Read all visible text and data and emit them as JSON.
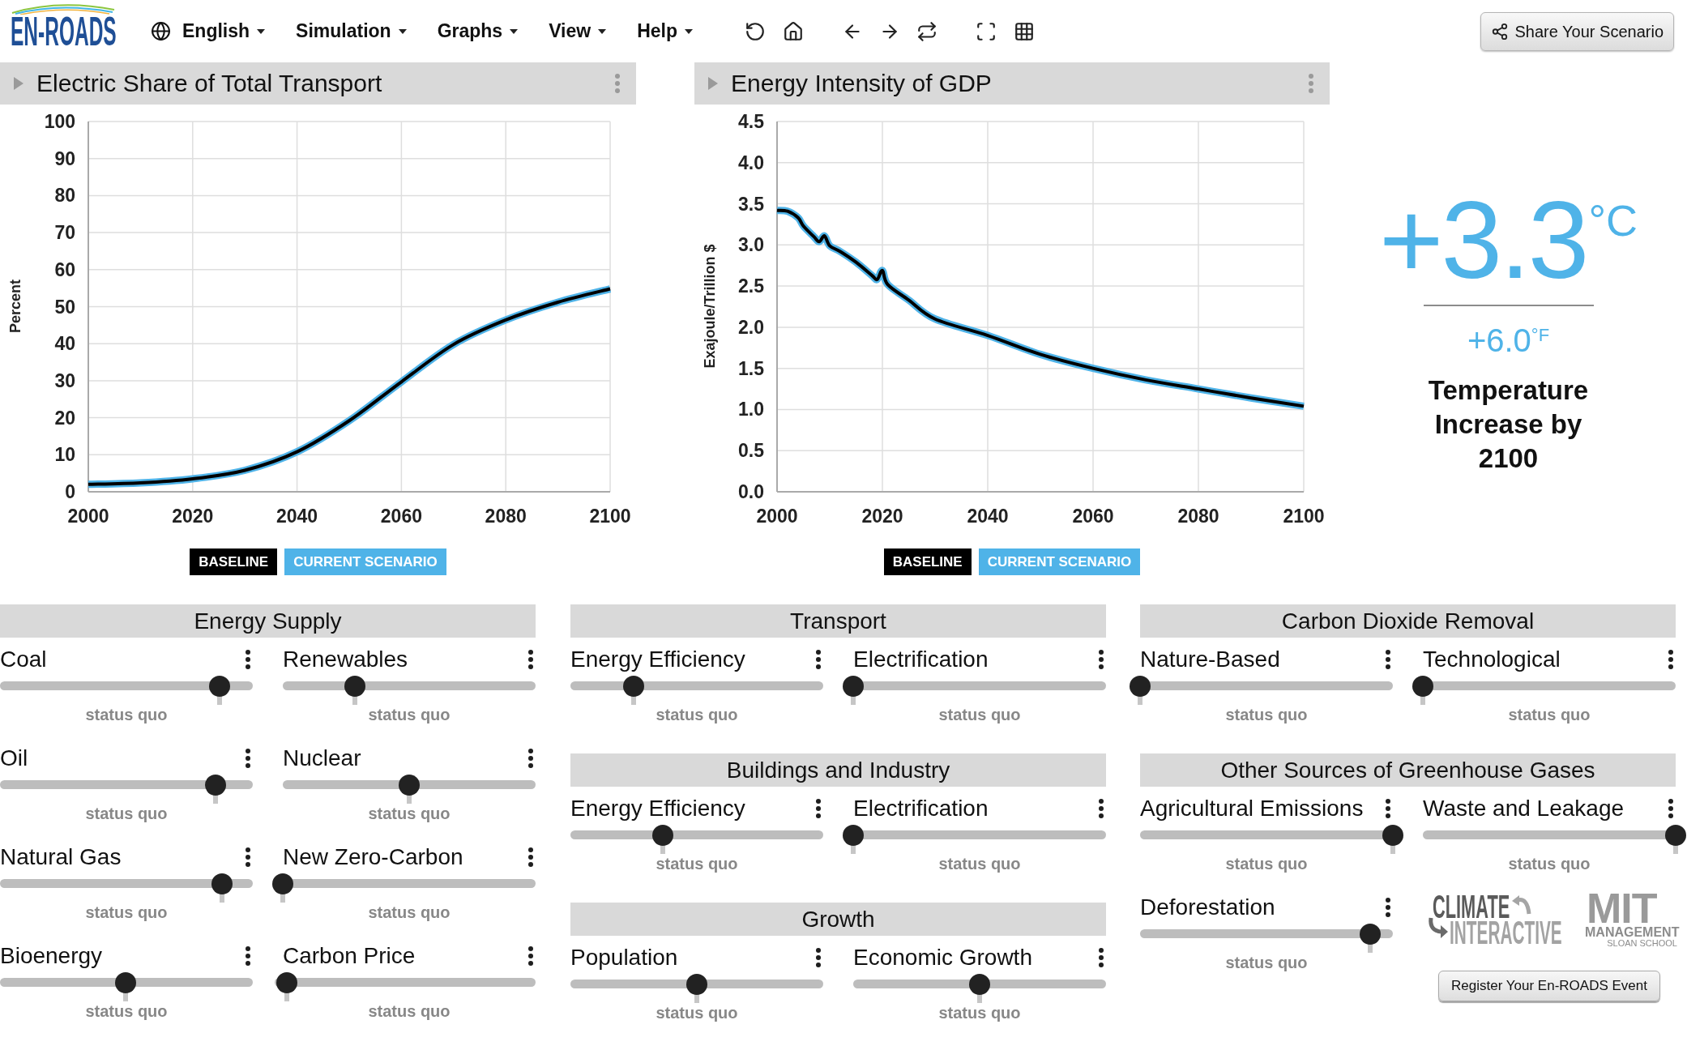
{
  "header": {
    "logo": "EN-ROADS",
    "menus": [
      {
        "kind": "language",
        "label": "English"
      },
      {
        "kind": "menu",
        "label": "Simulation"
      },
      {
        "kind": "menu",
        "label": "Graphs"
      },
      {
        "kind": "menu",
        "label": "View"
      },
      {
        "kind": "menu",
        "label": "Help"
      }
    ],
    "share_button": "Share Your Scenario"
  },
  "graphs": [
    {
      "title": "Electric Share of Total Transport",
      "chart_data": {
        "type": "line",
        "ylabel": "Percent",
        "x": [
          2000,
          2010,
          2020,
          2030,
          2040,
          2050,
          2060,
          2070,
          2080,
          2090,
          2100
        ],
        "series": [
          {
            "name": "BASELINE",
            "color": "#000000",
            "values": [
              2,
              2.4,
              3.5,
              5.8,
              10.8,
              19.2,
              29.7,
              39.8,
              46.4,
              51.2,
              54.8
            ]
          },
          {
            "name": "CURRENT SCENARIO",
            "color": "#4fb3e8",
            "values": [
              2,
              2.4,
              3.5,
              5.8,
              10.8,
              19.2,
              29.7,
              39.8,
              46.4,
              51.2,
              54.8
            ]
          }
        ],
        "xlim": [
          2000,
          2100
        ],
        "ylim": [
          0,
          100
        ],
        "xticks": [
          2000,
          2020,
          2040,
          2060,
          2080,
          2100
        ],
        "yticks": [
          0,
          10,
          20,
          30,
          40,
          50,
          60,
          70,
          80,
          90,
          100
        ],
        "grid": true
      }
    },
    {
      "title": "Energy Intensity of GDP",
      "chart_data": {
        "type": "line",
        "ylabel": "Exajoule/Trillion $",
        "x": [
          2000,
          2002,
          2004,
          2005,
          2007,
          2008,
          2009,
          2010,
          2012,
          2015,
          2018,
          2019,
          2020,
          2021,
          2025,
          2030,
          2040,
          2050,
          2060,
          2070,
          2080,
          2090,
          2100
        ],
        "series": [
          {
            "name": "BASELINE",
            "color": "#000000",
            "values": [
              3.42,
              3.41,
              3.33,
              3.23,
              3.1,
              3.04,
              3.11,
              2.99,
              2.92,
              2.79,
              2.63,
              2.58,
              2.69,
              2.52,
              2.33,
              2.1,
              1.9,
              1.67,
              1.5,
              1.36,
              1.25,
              1.14,
              1.04
            ]
          },
          {
            "name": "CURRENT SCENARIO",
            "color": "#4fb3e8",
            "values": [
              3.42,
              3.41,
              3.33,
              3.23,
              3.1,
              3.04,
              3.11,
              2.99,
              2.92,
              2.79,
              2.63,
              2.58,
              2.69,
              2.52,
              2.33,
              2.1,
              1.9,
              1.67,
              1.5,
              1.36,
              1.25,
              1.14,
              1.04
            ]
          }
        ],
        "xlim": [
          2000,
          2100
        ],
        "ylim": [
          0,
          4.5
        ],
        "xticks": [
          2000,
          2020,
          2040,
          2060,
          2080,
          2100
        ],
        "yticks": [
          {
            "value": 0,
            "label": "0.0"
          },
          {
            "value": 0.5,
            "label": "0.5"
          },
          {
            "value": 1,
            "label": "1.0"
          },
          {
            "value": 1.5,
            "label": "1.5"
          },
          {
            "value": 2,
            "label": "2.0"
          },
          {
            "value": 2.5,
            "label": "2.5"
          },
          {
            "value": 3,
            "label": "3.0"
          },
          {
            "value": 3.5,
            "label": "3.5"
          },
          {
            "value": 4,
            "label": "4.0"
          },
          {
            "value": 4.5,
            "label": "4.5"
          }
        ],
        "grid": true
      }
    }
  ],
  "temperature": {
    "value": "+3.3",
    "unit": "°C",
    "secondary_value": "+6.0",
    "secondary_unit": "°F",
    "caption": "Temperature Increase by 2100"
  },
  "slider_columns": [
    {
      "sections": [
        {
          "title": "Energy Supply",
          "sliders": [
            {
              "label": "Coal",
              "level": 0.87,
              "caption": "status quo"
            },
            {
              "label": "Renewables",
              "level": 0.284,
              "caption": "status quo"
            },
            {
              "label": "Oil",
              "level": 0.852,
              "caption": "status quo"
            },
            {
              "label": "Nuclear",
              "level": 0.5,
              "caption": "status quo"
            },
            {
              "label": "Natural Gas",
              "level": 0.879,
              "caption": "status quo"
            },
            {
              "label": "New Zero-Carbon",
              "level": 0,
              "caption": "status quo"
            },
            {
              "label": "Bioenergy",
              "level": 0.498,
              "caption": "status quo"
            },
            {
              "label": "Carbon Price",
              "level": 0.017,
              "caption": "status quo"
            }
          ]
        }
      ]
    },
    {
      "sections": [
        {
          "title": "Transport",
          "sliders": [
            {
              "label": "Energy Efficiency",
              "level": 0.249,
              "caption": "status quo"
            },
            {
              "label": "Electrification",
              "level": 0,
              "caption": "status quo"
            }
          ]
        },
        {
          "title": "Buildings and Industry",
          "sliders": [
            {
              "label": "Energy Efficiency",
              "level": 0.366,
              "caption": "status quo"
            },
            {
              "label": "Electrification",
              "level": 0,
              "caption": "status quo"
            }
          ]
        },
        {
          "title": "Growth",
          "sliders": [
            {
              "label": "Population",
              "level": 0.5,
              "caption": "status quo"
            },
            {
              "label": "Economic Growth",
              "level": 0.5,
              "caption": "status quo"
            }
          ]
        }
      ]
    },
    {
      "sections": [
        {
          "title": "Carbon Dioxide Removal",
          "sliders": [
            {
              "label": "Nature-Based",
              "level": 0,
              "caption": "status quo"
            },
            {
              "label": "Technological",
              "level": 0,
              "caption": "status quo"
            }
          ]
        },
        {
          "title": "Other Sources of Greenhouse Gases",
          "sliders": [
            {
              "label": "Agricultural Emissions",
              "level": 1,
              "caption": "status quo"
            },
            {
              "label": "Waste and Leakage",
              "level": 1,
              "caption": "status quo"
            },
            {
              "label": "Deforestation",
              "level": 0.909,
              "caption": "status quo"
            }
          ]
        }
      ],
      "logos": [
        {
          "kind": "climate_interactive",
          "lines": [
            "CLIMATE",
            "INTERACTIVE"
          ]
        },
        {
          "kind": "mit",
          "lines": [
            "MIT",
            "MANAGEMENT",
            "SLOAN SCHOOL"
          ]
        }
      ],
      "register_button": "Register Your En-ROADS Event"
    }
  ]
}
